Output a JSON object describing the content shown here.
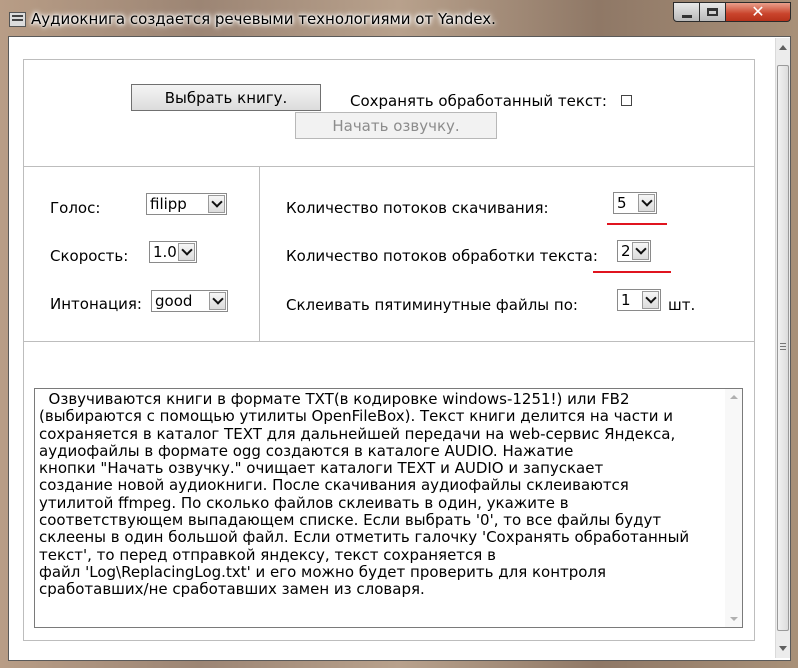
{
  "window": {
    "title": "Аудиокнига создается речевыми технологиями от Yandex.",
    "minimize_glyph": "",
    "close_glyph": "✕"
  },
  "top": {
    "choose_book_label": "Выбрать книгу.",
    "save_text_label": "Сохранять обработанный текст:",
    "save_text_checked": false,
    "start_label": "Начать озвучку.",
    "start_enabled": false
  },
  "voice_panel": {
    "voice_label": "Голос:",
    "voice_value": "filipp",
    "speed_label": "Скорость:",
    "speed_value": "1.0",
    "intonation_label": "Интонация:",
    "intonation_value": "good"
  },
  "threads_panel": {
    "download_label": "Количество потоков скачивания:",
    "download_value": "5",
    "process_label": "Количество потоков обработки текста:",
    "process_value": "2",
    "merge_label": "Склеивать пятиминутные файлы по:",
    "merge_value": "1",
    "merge_unit": "шт."
  },
  "description": {
    "text": "  Озвучиваются книги в формате TXT(в кодировке windows-1251!) или FB2\n(выбираются с помощью утилиты OpenFileBox). Текст книги делится на части и\nсохраняется в каталог TEXT для дальнейшей передачи на web-сервис Яндекса,\nаудиофайлы в формате ogg создаются в каталоге AUDIO. Нажатие\nкнопки \"Начать озвучку.\" очищает каталоги TEXT и AUDIO и запускает\nсоздание новой аудиокниги. После скачивания аудиофайлы склеиваются\nутилитой ffmpeg. По сколько файлов склеивать в один, укажите в\nсоответствующем выпадающем списке. Если выбрать '0', то все файлы будут\nсклеены в один большой файл. Если отметить галочку 'Сохранять обработанный\nтекст', то перед отправкой яндексу, текст сохраняется в\nфайл 'Log\\ReplacingLog.txt' и его можно будет проверить для контроля\nсработавших/не сработавших замен из словаря."
  },
  "colors": {
    "highlight": "#e0141f",
    "close_button": "#c9442c"
  }
}
